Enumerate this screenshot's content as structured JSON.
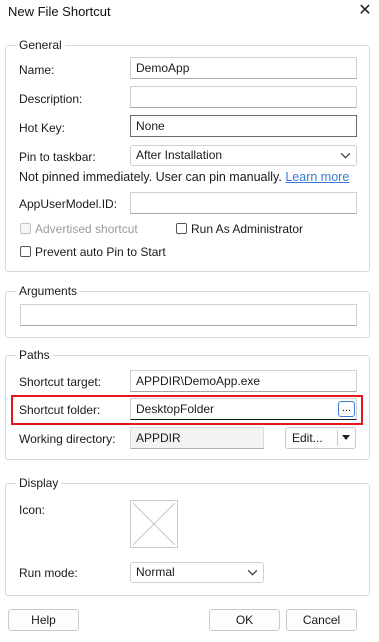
{
  "dialog": {
    "title": "New File Shortcut"
  },
  "general": {
    "title": "General",
    "name_label": "Name:",
    "name_value": "DemoApp",
    "description_label": "Description:",
    "description_value": "",
    "hotkey_label": "Hot Key:",
    "hotkey_value": "None",
    "pin_label": "Pin to taskbar:",
    "pin_value": "After Installation",
    "pin_note": "Not pinned immediately. User can pin manually.",
    "learn_more": "Learn more",
    "appid_label": "AppUserModel.ID:",
    "appid_value": "",
    "advertised_label": "Advertised shortcut",
    "run_admin_label": "Run As Administrator",
    "prevent_pin_label": "Prevent auto Pin to Start"
  },
  "arguments": {
    "title": "Arguments",
    "value": ""
  },
  "paths": {
    "title": "Paths",
    "target_label": "Shortcut target:",
    "target_value": "APPDIR\\DemoApp.exe",
    "folder_label": "Shortcut folder:",
    "folder_value": "DesktopFolder",
    "browse_label": "...",
    "workdir_label": "Working directory:",
    "workdir_value": "APPDIR",
    "edit_label": "Edit..."
  },
  "display": {
    "title": "Display",
    "icon_label": "Icon:",
    "runmode_label": "Run mode:",
    "runmode_value": "Normal"
  },
  "footer": {
    "help": "Help",
    "ok": "OK",
    "cancel": "Cancel"
  },
  "colors": {
    "highlight": "#e3171b",
    "link": "#3a7bd5"
  }
}
